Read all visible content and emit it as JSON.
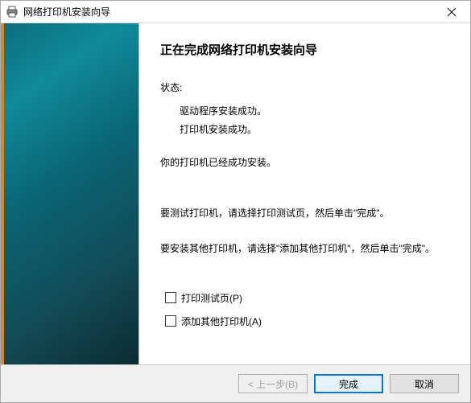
{
  "titlebar": {
    "title": "网络打印机安装向导"
  },
  "main": {
    "heading": "正在完成网络打印机安装向导",
    "status_label": "状态:",
    "status_line1": "驱动程序安装成功。",
    "status_line2": "打印机安装成功。",
    "success_msg": "你的打印机已经成功安装。",
    "instr_test": "要测试打印机，请选择打印测试页，然后单击\"完成\"。",
    "instr_add": "要安装其他打印机，请选择\"添加其他打印机\"，然后单击\"完成\"。"
  },
  "checkboxes": {
    "print_test": "打印测试页(P)",
    "add_other": "添加其他打印机(A)"
  },
  "footer": {
    "back": "< 上一步(B)",
    "finish": "完成",
    "cancel": "取消"
  }
}
